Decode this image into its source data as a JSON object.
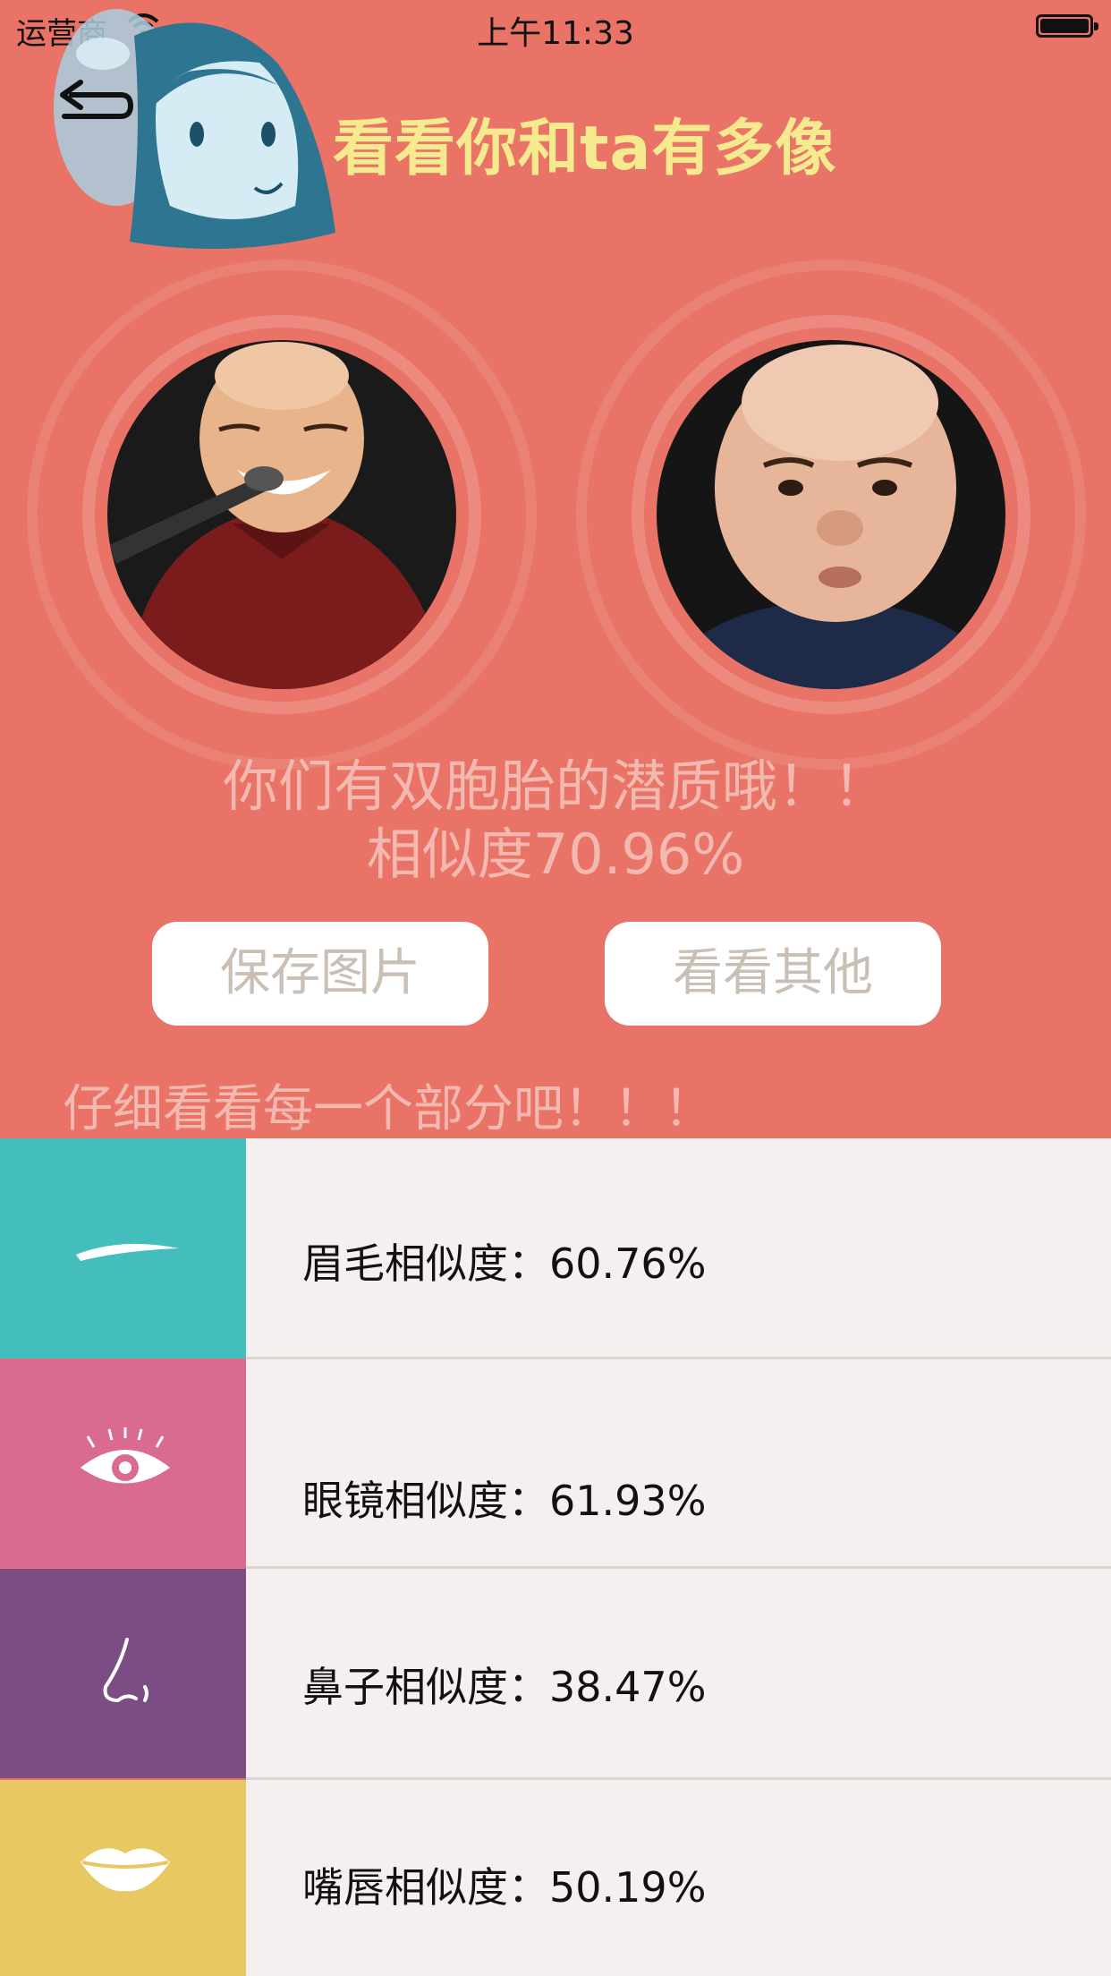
{
  "status": {
    "carrier": "运营商",
    "time": "上午11:33"
  },
  "header": {
    "title": "看看你和ta有多像"
  },
  "result": {
    "message": "你们有双胞胎的潜质哦！！",
    "similarity": "相似度70.96%"
  },
  "buttons": {
    "save": "保存图片",
    "other": "看看其他"
  },
  "section": {
    "title": "仔细看看每一个部分吧！！！"
  },
  "features": [
    {
      "label": "眉毛相似度：60.76%",
      "color": "#44bdbd",
      "icon": "eyebrow-icon"
    },
    {
      "label": "眼镜相似度：61.93%",
      "color": "#d96b93",
      "icon": "eye-icon"
    },
    {
      "label": "鼻子相似度：38.47%",
      "color": "#7c4c85",
      "icon": "nose-icon"
    },
    {
      "label": "嘴唇相似度：50.19%",
      "color": "#e8c862",
      "icon": "lips-icon"
    }
  ],
  "colors": {
    "background": "#e87366",
    "title": "#f6ea8e",
    "result_text": "#f3b9b0",
    "row_bg": "#f5efef"
  }
}
